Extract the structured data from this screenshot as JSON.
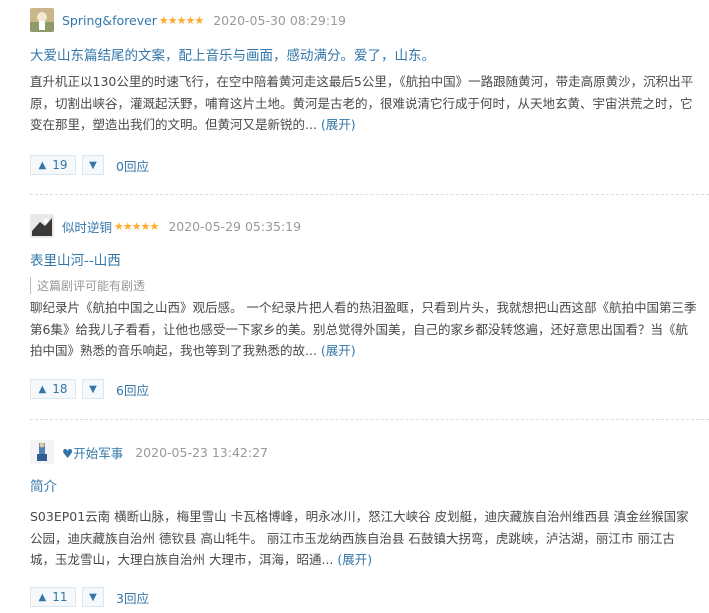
{
  "reviews": [
    {
      "author": "Spring&forever",
      "stars": "★★★★★",
      "time": "2020-05-30 08:29:19",
      "title": "大爱山东篇结尾的文案，配上音乐与画面，感动满分。爱了，山东。",
      "spoiler": "",
      "body": "直升机正以130公里的时速飞行，在空中陪着黄河走这最后5公里，《航拍中国》一路跟随黄河，带走高原黄沙，沉积出平原，切割出峡谷，灌溉起沃野，哺育这片土地。黄河是古老的，很难说清它行成于何时，从天地玄黄、宇宙洪荒之时，它变在那里，塑造出我们的文明。但黄河又是新锐的...",
      "more": "(展开)",
      "up_count": "19",
      "replies": "0回应"
    },
    {
      "author": "似时逆铜",
      "stars": "★★★★★",
      "time": "2020-05-29 05:35:19",
      "title": "表里山河--山西",
      "spoiler": "这篇剧评可能有剧透",
      "body": "聊纪录片《航拍中国之山西》观后感。 一个纪录片把人看的热泪盈眶，只看到片头，我就想把山西这部《航拍中国第三季第6集》给我儿子看看，让他也感受一下家乡的美。别总觉得外国美，自己的家乡都没转悠遍，还好意思出国看？当《航拍中国》熟悉的音乐响起，我也等到了我熟悉的故...",
      "more": "(展开)",
      "up_count": "18",
      "replies": "6回应"
    },
    {
      "author": "♥开始军事",
      "stars": "",
      "time": "2020-05-23 13:42:27",
      "title": "简介",
      "spoiler": "",
      "body": "S03EP01云南 横断山脉，梅里雪山 卡瓦格博峰，明永冰川，怒江大峡谷 皮划艇，迪庆藏族自治州维西县 滇金丝猴国家公园，迪庆藏族自治州 德钦县 高山牦牛。 丽江市玉龙纳西族自治县 石鼓镇大拐弯，虎跳峡，泸沽湖，丽江市 丽江古城，玉龙雪山，大理白族自治州 大理市，洱海，昭通...",
      "more": "(展开)",
      "up_count": "11",
      "replies": "3回应"
    }
  ],
  "icons": {
    "up": "▲",
    "down": "▼"
  },
  "colors": {
    "link": "#3377aa",
    "star": "#ffac2d",
    "meta": "#999999",
    "text": "#494949"
  }
}
